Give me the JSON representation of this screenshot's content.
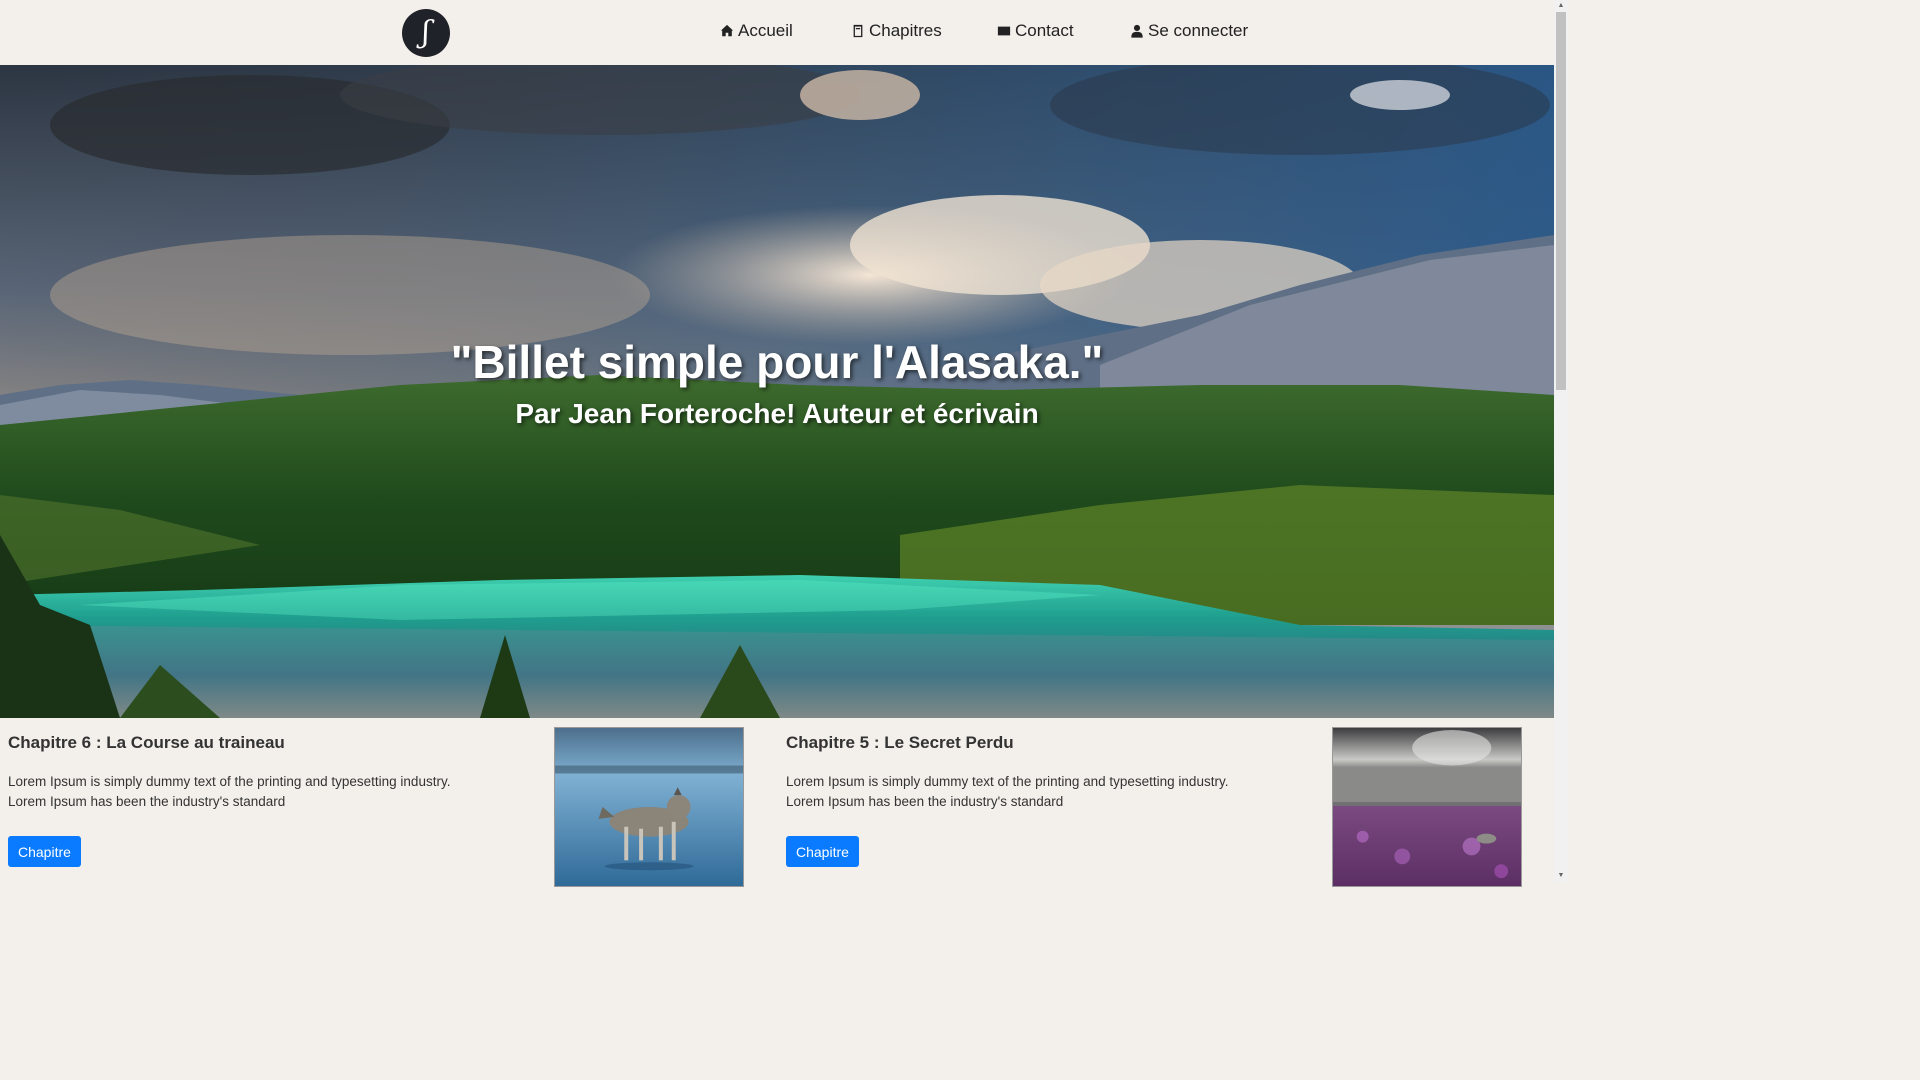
{
  "nav": {
    "logo_letter": "ʃ",
    "items": [
      {
        "label": "Accueil",
        "icon": "home-icon"
      },
      {
        "label": "Chapitres",
        "icon": "book-icon"
      },
      {
        "label": "Contact",
        "icon": "envelope-icon"
      },
      {
        "label": "Se connecter",
        "icon": "user-icon"
      }
    ]
  },
  "hero": {
    "title": "\"Billet simple pour l'Alasaka.\"",
    "subtitle": "Par Jean Forteroche! Auteur et écrivain"
  },
  "chapters": [
    {
      "title": "Chapitre 6 : La Course au traineau",
      "excerpt": "Lorem Ipsum is simply dummy text of the printing and typesetting industry. Lorem Ipsum has been the industry's standard",
      "button": "Chapitre"
    },
    {
      "title": "Chapitre 5 : Le Secret Perdu",
      "excerpt": "Lorem Ipsum is simply dummy text of the printing and typesetting industry. Lorem Ipsum has been the industry's standard",
      "button": "Chapitre"
    }
  ],
  "colors": {
    "background": "#f3f0eb",
    "button": "#0a7bff",
    "logo": "#1f2228"
  }
}
